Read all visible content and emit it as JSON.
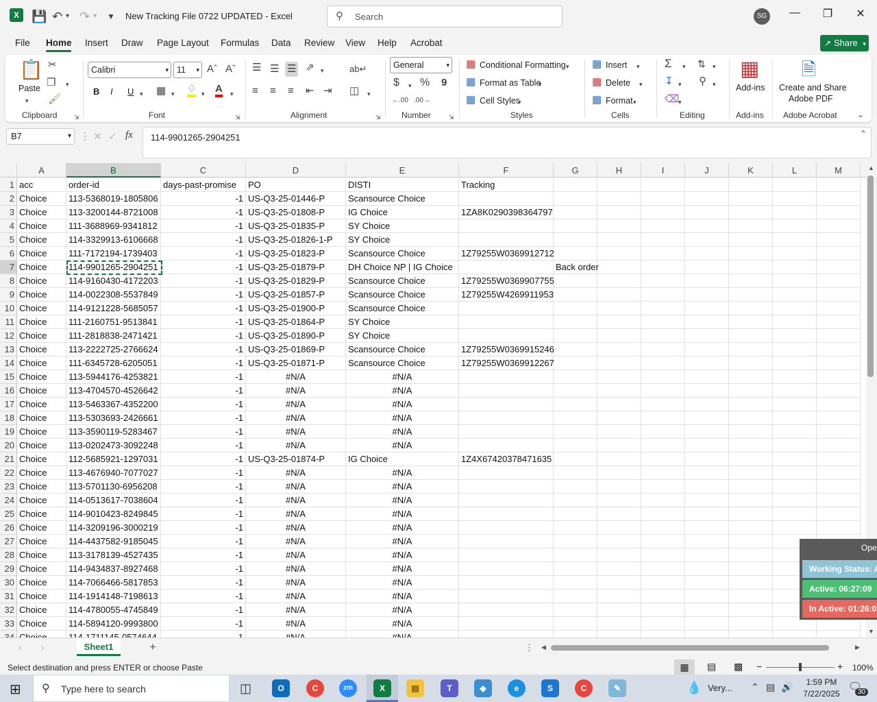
{
  "window": {
    "title": "New Tracking File 0722 UPDATED  -  Excel",
    "search_placeholder": "Search",
    "avatar_initials": "SG"
  },
  "menu": {
    "tabs": [
      "File",
      "Home",
      "Insert",
      "Draw",
      "Page Layout",
      "Formulas",
      "Data",
      "Review",
      "View",
      "Help",
      "Acrobat"
    ],
    "share_label": "Share"
  },
  "ribbon": {
    "clipboard": {
      "paste": "Paste",
      "group": "Clipboard"
    },
    "font": {
      "name": "Calibri",
      "size": "11",
      "group": "Font",
      "bold": "B",
      "italic": "I",
      "underline": "U"
    },
    "alignment": {
      "group": "Alignment"
    },
    "number": {
      "format": "General",
      "group": "Number",
      "currency": "$",
      "percent": "%",
      "comma": "9"
    },
    "styles": {
      "conditional": "Conditional Formatting",
      "format_table": "Format as Table",
      "cell_styles": "Cell Styles",
      "group": "Styles"
    },
    "cells": {
      "insert": "Insert",
      "delete": "Delete",
      "format": "Format",
      "group": "Cells"
    },
    "editing": {
      "group": "Editing"
    },
    "addins": {
      "label": "Add-ins",
      "group": "Add-ins"
    },
    "acrobat": {
      "label_line1": "Create and Share",
      "label_line2": "Adobe PDF",
      "group": "Adobe Acrobat"
    }
  },
  "formula_bar": {
    "name_box": "B7",
    "fx": "fx",
    "value": "114-9901265-2904251"
  },
  "columns": [
    "A",
    "B",
    "C",
    "D",
    "E",
    "F",
    "G",
    "H",
    "I",
    "J",
    "K",
    "L",
    "M"
  ],
  "selected_column": "B",
  "selected_row": 7,
  "rows": [
    {
      "n": 1,
      "cells": [
        "acc",
        "order-id",
        "days-past-promise",
        "PO",
        "DISTI",
        "Tracking",
        "",
        ""
      ]
    },
    {
      "n": 2,
      "cells": [
        "Choice",
        "113-5368019-1805806",
        "-1",
        "US-Q3-25-01446-P",
        "Scansource Choice",
        "",
        "",
        ""
      ]
    },
    {
      "n": 3,
      "cells": [
        "Choice",
        "113-3200144-8721008",
        "-1",
        "US-Q3-25-01808-P",
        "IG Choice",
        "1ZA8K0290398364797",
        "",
        ""
      ]
    },
    {
      "n": 4,
      "cells": [
        "Choice",
        "111-3688969-9341812",
        "-1",
        "US-Q3-25-01835-P",
        "SY Choice",
        "",
        "",
        ""
      ]
    },
    {
      "n": 5,
      "cells": [
        "Choice",
        "114-3329913-6106668",
        "-1",
        "US-Q3-25-01826-1-P",
        "SY Choice",
        "",
        "",
        ""
      ]
    },
    {
      "n": 6,
      "cells": [
        "Choice",
        "111-7172194-1739403",
        "-1",
        "US-Q3-25-01823-P",
        "Scansource Choice",
        "1Z79255W0369912712",
        "",
        ""
      ]
    },
    {
      "n": 7,
      "cells": [
        "Choice",
        "114-9901265-2904251",
        "-1",
        "US-Q3-25-01879-P",
        "DH Choice NP | IG Choice",
        "",
        "Back order",
        ""
      ]
    },
    {
      "n": 8,
      "cells": [
        "Choice",
        "114-9160430-4172203",
        "-1",
        "US-Q3-25-01829-P",
        "Scansource Choice",
        "1Z79255W0369907755",
        "",
        ""
      ]
    },
    {
      "n": 9,
      "cells": [
        "Choice",
        "114-0022308-5537849",
        "-1",
        "US-Q3-25-01857-P",
        "Scansource Choice",
        "1Z79255W4269911953",
        "",
        ""
      ]
    },
    {
      "n": 10,
      "cells": [
        "Choice",
        "114-9121228-5685057",
        "-1",
        "US-Q3-25-01900-P",
        "Scansource Choice",
        "",
        "",
        ""
      ]
    },
    {
      "n": 11,
      "cells": [
        "Choice",
        "111-2160751-9513841",
        "-1",
        "US-Q3-25-01864-P",
        "SY Choice",
        "",
        "",
        ""
      ]
    },
    {
      "n": 12,
      "cells": [
        "Choice",
        "111-2818838-2471421",
        "-1",
        "US-Q3-25-01890-P",
        "SY Choice",
        "",
        "",
        ""
      ]
    },
    {
      "n": 13,
      "cells": [
        "Choice",
        "113-2222725-2766624",
        "-1",
        "US-Q3-25-01869-P",
        "Scansource Choice",
        "1Z79255W0369915246",
        "",
        ""
      ]
    },
    {
      "n": 14,
      "cells": [
        "Choice",
        "111-6345728-6205051",
        "-1",
        "US-Q3-25-01871-P",
        "Scansource Choice",
        "1Z79255W0369912267",
        "",
        ""
      ]
    },
    {
      "n": 15,
      "cells": [
        "Choice",
        "113-5944176-4253821",
        "-1",
        "#N/A",
        "#N/A",
        "",
        "",
        ""
      ]
    },
    {
      "n": 16,
      "cells": [
        "Choice",
        "113-4704570-4526642",
        "-1",
        "#N/A",
        "#N/A",
        "",
        "",
        ""
      ]
    },
    {
      "n": 17,
      "cells": [
        "Choice",
        "113-5463367-4352200",
        "-1",
        "#N/A",
        "#N/A",
        "",
        "",
        ""
      ]
    },
    {
      "n": 18,
      "cells": [
        "Choice",
        "113-5303693-2426661",
        "-1",
        "#N/A",
        "#N/A",
        "",
        "",
        ""
      ]
    },
    {
      "n": 19,
      "cells": [
        "Choice",
        "113-3590119-5283467",
        "-1",
        "#N/A",
        "#N/A",
        "",
        "",
        ""
      ]
    },
    {
      "n": 20,
      "cells": [
        "Choice",
        "113-0202473-3092248",
        "-1",
        "#N/A",
        "#N/A",
        "",
        "",
        ""
      ]
    },
    {
      "n": 21,
      "cells": [
        "Choice",
        "112-5685921-1297031",
        "-1",
        "US-Q3-25-01874-P",
        "IG Choice",
        "1Z4X67420378471635",
        "",
        ""
      ]
    },
    {
      "n": 22,
      "cells": [
        "Choice",
        "113-4676940-7077027",
        "-1",
        "#N/A",
        "#N/A",
        "",
        "",
        ""
      ]
    },
    {
      "n": 23,
      "cells": [
        "Choice",
        "113-5701130-6956208",
        "-1",
        "#N/A",
        "#N/A",
        "",
        "",
        ""
      ]
    },
    {
      "n": 24,
      "cells": [
        "Choice",
        "114-0513617-7038604",
        "-1",
        "#N/A",
        "#N/A",
        "",
        "",
        ""
      ]
    },
    {
      "n": 25,
      "cells": [
        "Choice",
        "114-9010423-8249845",
        "-1",
        "#N/A",
        "#N/A",
        "",
        "",
        ""
      ]
    },
    {
      "n": 26,
      "cells": [
        "Choice",
        "114-3209196-3000219",
        "-1",
        "#N/A",
        "#N/A",
        "",
        "",
        ""
      ]
    },
    {
      "n": 27,
      "cells": [
        "Choice",
        "114-4437582-9185045",
        "-1",
        "#N/A",
        "#N/A",
        "",
        "",
        ""
      ]
    },
    {
      "n": 28,
      "cells": [
        "Choice",
        "113-3178139-4527435",
        "-1",
        "#N/A",
        "#N/A",
        "",
        "",
        ""
      ]
    },
    {
      "n": 29,
      "cells": [
        "Choice",
        "114-9434837-8927468",
        "-1",
        "#N/A",
        "#N/A",
        "",
        "",
        ""
      ]
    },
    {
      "n": 30,
      "cells": [
        "Choice",
        "114-7066466-5817853",
        "-1",
        "#N/A",
        "#N/A",
        "",
        "",
        ""
      ]
    },
    {
      "n": 31,
      "cells": [
        "Choice",
        "114-1914148-7198613",
        "-1",
        "#N/A",
        "#N/A",
        "",
        "",
        ""
      ]
    },
    {
      "n": 32,
      "cells": [
        "Choice",
        "114-4780055-4745849",
        "-1",
        "#N/A",
        "#N/A",
        "",
        "",
        ""
      ]
    },
    {
      "n": 33,
      "cells": [
        "Choice",
        "114-5894120-9993800",
        "-1",
        "#N/A",
        "#N/A",
        "",
        "",
        ""
      ]
    },
    {
      "n": 34,
      "cells": [
        "Choice",
        "114-1711145-0574644",
        "-1",
        "#N/A",
        "#N/A",
        "",
        "",
        ""
      ]
    }
  ],
  "sheet": {
    "tab": "Sheet1",
    "add": "+"
  },
  "status": {
    "message": "Select destination and press ENTER or choose Paste",
    "zoom": "100%"
  },
  "overlay": {
    "header": "Oper",
    "working": "Working Status: A",
    "active": "Active: 06:27:09",
    "inactive": "In Active: 01:26:0"
  },
  "taskbar": {
    "search_placeholder": "Type here to search",
    "weather": "Very...",
    "time": "1:59 PM",
    "date": "7/22/2025",
    "notifications": "30"
  },
  "colors": {
    "accent": "#107c41",
    "overlay_working": "#8fc4d6",
    "overlay_active": "#4bbf73",
    "overlay_inactive": "#e8675e"
  }
}
